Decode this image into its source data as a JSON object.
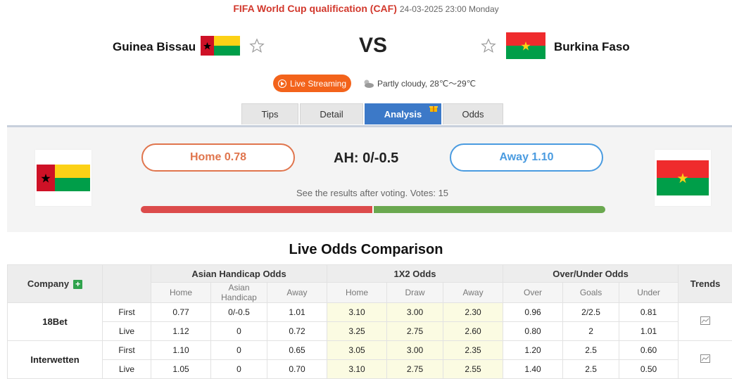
{
  "match": {
    "league": "FIFA World Cup qualification (CAF)",
    "datetime": "24-03-2025 23:00 Monday",
    "home": "Guinea Bissau",
    "away": "Burkina Faso",
    "vs": "VS"
  },
  "live_label": "Live Streaming",
  "weather": "Partly cloudy, 28℃～29℃",
  "tabs": [
    "Tips",
    "Detail",
    "Analysis",
    "Odds"
  ],
  "active_tab": "Analysis",
  "vote": {
    "home_label": "Home 0.78",
    "away_label": "Away 1.10",
    "ah": "AH: 0/-0.5",
    "note": "See the results after voting. Votes: 15",
    "home_share": 0.5,
    "away_share": 0.5
  },
  "odds": {
    "title": "Live Odds Comparison",
    "company_header": "Company",
    "groups": [
      "Asian Handicap Odds",
      "1X2 Odds",
      "Over/Under Odds"
    ],
    "trends_header": "Trends",
    "subheaders": [
      "Home",
      "Asian Handicap",
      "Away",
      "Home",
      "Draw",
      "Away",
      "Over",
      "Goals",
      "Under"
    ],
    "rows": [
      {
        "company": "18Bet",
        "lines": [
          {
            "type": "First",
            "vals": [
              "0.77",
              "0/-0.5",
              "1.01",
              "3.10",
              "3.00",
              "2.30",
              "0.96",
              "2/2.5",
              "0.81"
            ]
          },
          {
            "type": "Live",
            "vals": [
              "1.12",
              "0",
              "0.72",
              "3.25",
              "2.75",
              "2.60",
              "0.80",
              "2",
              "1.01"
            ]
          }
        ]
      },
      {
        "company": "Interwetten",
        "lines": [
          {
            "type": "First",
            "vals": [
              "1.10",
              "0",
              "0.65",
              "3.05",
              "3.00",
              "2.35",
              "1.20",
              "2.5",
              "0.60"
            ]
          },
          {
            "type": "Live",
            "vals": [
              "1.05",
              "0",
              "0.70",
              "3.10",
              "2.75",
              "2.55",
              "1.40",
              "2.5",
              "0.50"
            ]
          }
        ]
      }
    ]
  },
  "colors": {
    "accent_red": "#d2382c",
    "live_orange": "#f3631b",
    "tab_blue": "#3c79c8",
    "home_orange": "#e0754d",
    "away_blue": "#4a9be0",
    "bar_red": "#dc4b4b",
    "bar_green": "#6aa84f"
  }
}
